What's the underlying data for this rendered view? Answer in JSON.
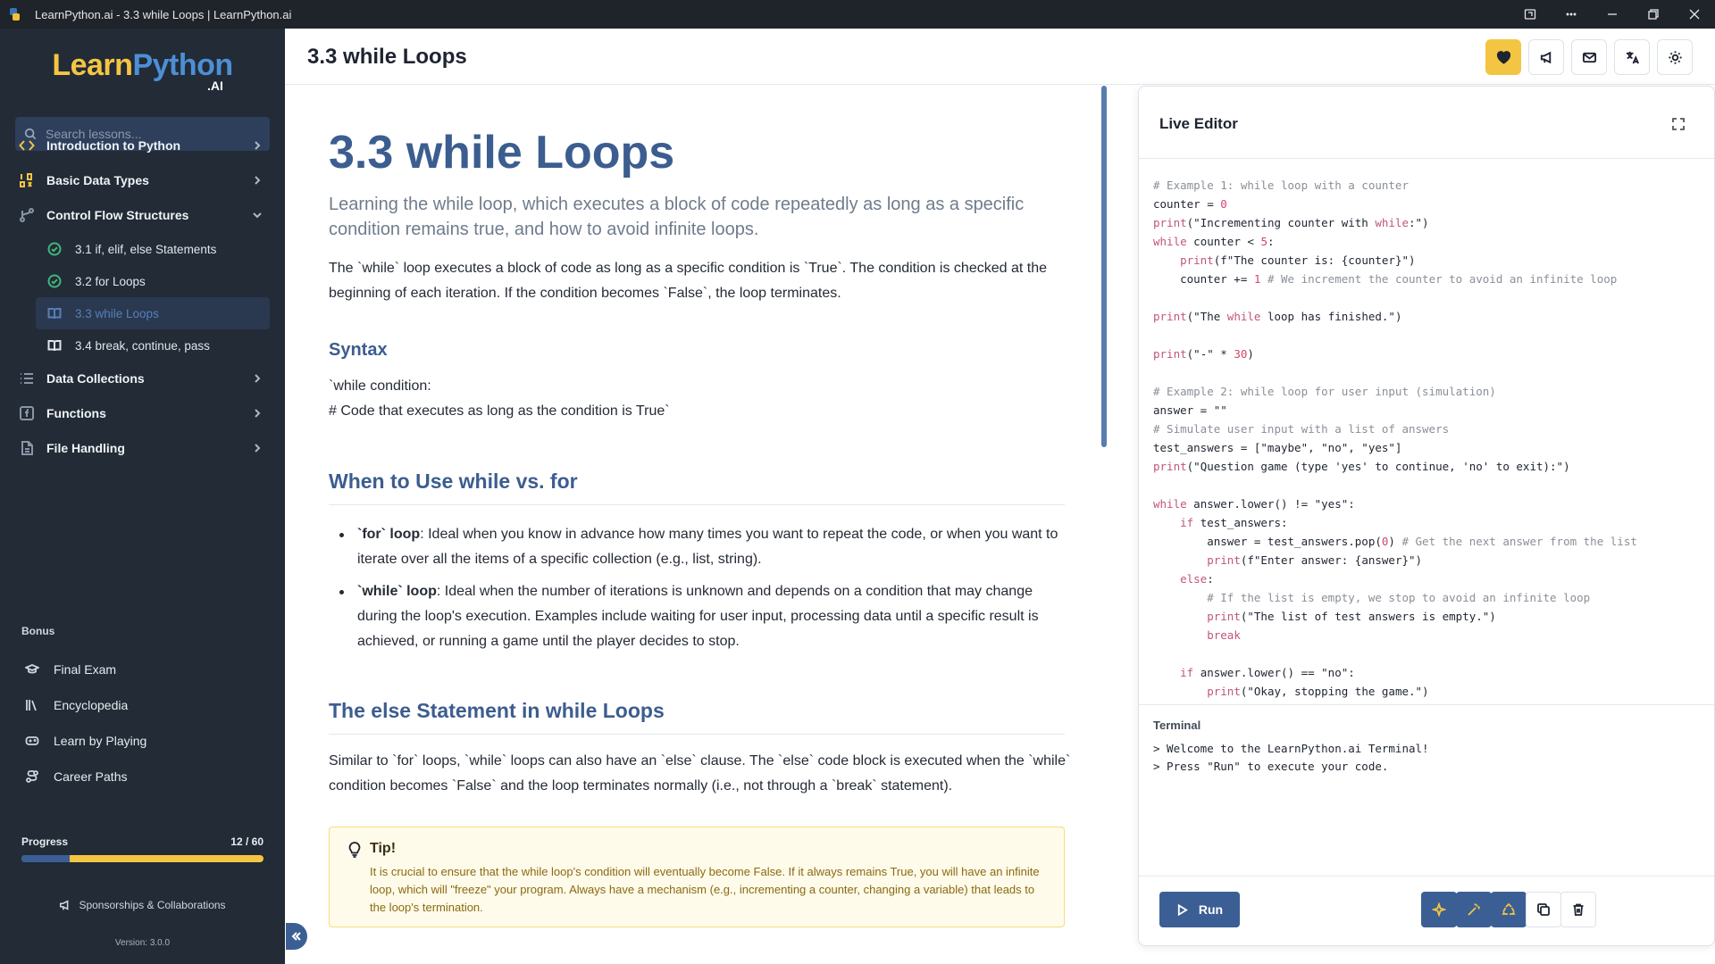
{
  "window": {
    "title": "LearnPython.ai - 3.3 while Loops | LearnPython.ai",
    "controls": [
      "app-view-icon",
      "more-icon",
      "minimize-icon",
      "restore-icon",
      "close-icon"
    ]
  },
  "sidebar": {
    "logo": {
      "learn": "Learn",
      "python": "Python",
      "ai": ".AI"
    },
    "search_placeholder": "Search lessons...",
    "sections": [
      {
        "label": "Introduction to Python",
        "icon": "code-icon",
        "expanded": false
      },
      {
        "label": "Basic Data Types",
        "icon": "data-types-icon",
        "expanded": false
      },
      {
        "label": "Control Flow Structures",
        "icon": "branch-icon",
        "expanded": true
      },
      {
        "label": "Data Collections",
        "icon": "list-icon",
        "expanded": false
      },
      {
        "label": "Functions",
        "icon": "function-icon",
        "expanded": false
      },
      {
        "label": "File Handling",
        "icon": "file-icon",
        "expanded": false
      }
    ],
    "lessons": [
      {
        "label": "3.1 if, elif, else Statements",
        "status": "completed",
        "icon": "check-circle-icon"
      },
      {
        "label": "3.2 for Loops",
        "status": "completed",
        "icon": "check-circle-icon"
      },
      {
        "label": "3.3 while Loops",
        "status": "active",
        "icon": "book-open-icon"
      },
      {
        "label": "3.4 break, continue, pass",
        "status": "pending",
        "icon": "book-open-icon"
      }
    ],
    "bonus_heading": "Bonus",
    "bonus": [
      {
        "label": "Final Exam",
        "icon": "graduation-cap-icon"
      },
      {
        "label": "Encyclopedia",
        "icon": "library-icon"
      },
      {
        "label": "Learn by Playing",
        "icon": "gamepad-icon"
      },
      {
        "label": "Career Paths",
        "icon": "route-icon"
      }
    ],
    "progress": {
      "label": "Progress",
      "text": "12 / 60",
      "fraction": 0.2
    },
    "sponsor": "Sponsorships & Collaborations",
    "version": "Version: 3.0.0"
  },
  "header": {
    "title": "3.3 while Loops",
    "buttons": [
      "heart-icon",
      "megaphone-icon",
      "mail-icon",
      "translate-icon",
      "sun-icon"
    ]
  },
  "article": {
    "h1": "3.3 while Loops",
    "lead": "Learning the while loop, which executes a block of code repeatedly as long as a specific condition remains true, and how to avoid infinite loops.",
    "intro": "The `while` loop executes a block of code as long as a specific condition is `True`. The condition is checked at the beginning of each iteration. If the condition becomes `False`, the loop terminates.",
    "syntax_heading": "Syntax",
    "syntax_line1": "`while condition:",
    "syntax_line2": "# Code that executes as long as the condition is True`",
    "when_heading": "When to Use while vs. for",
    "bullets": [
      {
        "term": "`for` loop",
        "text": ": Ideal when you know in advance how many times you want to repeat the code, or when you want to iterate over all the items of a specific collection (e.g., list, string)."
      },
      {
        "term": "`while` loop",
        "text": ": Ideal when the number of iterations is unknown and depends on a condition that may change during the loop's execution. Examples include waiting for user input, processing data until a specific result is achieved, or running a game until the player decides to stop."
      }
    ],
    "else_heading": "The else Statement in while Loops",
    "else_text": "Similar to `for` loops, `while` loops can also have an `else` clause. The `else` code block is executed when the `while` condition becomes `False` and the loop terminates normally (i.e., not through a `break` statement).",
    "tip_title": "Tip!",
    "tip_text": "It is crucial to ensure that the while loop's condition will eventually become False. If it always remains True, you will have an infinite loop, which will \"freeze\" your program. Always have a mechanism (e.g., incrementing a counter, changing a variable) that leads to the loop's termination."
  },
  "editor": {
    "title": "Live Editor",
    "code": [
      "# Example 1: while loop with a counter",
      "counter = 0",
      "print(\"Incrementing counter with while:\")",
      "while counter < 5:",
      "    print(f\"The counter is: {counter}\")",
      "    counter += 1 # We increment the counter to avoid an infinite loop",
      "",
      "print(\"The while loop has finished.\")",
      "",
      "print(\"-\" * 30)",
      "",
      "# Example 2: while loop for user input (simulation)",
      "answer = \"\"",
      "# Simulate user input with a list of answers",
      "test_answers = [\"maybe\", \"no\", \"yes\"]",
      "print(\"Question game (type 'yes' to continue, 'no' to exit):\")",
      "",
      "while answer.lower() != \"yes\":",
      "    if test_answers:",
      "        answer = test_answers.pop(0) # Get the next answer from the list",
      "        print(f\"Enter answer: {answer}\")",
      "    else:",
      "        # If the list is empty, we stop to avoid an infinite loop",
      "        print(\"The list of test answers is empty.\")",
      "        break",
      "",
      "    if answer.lower() == \"no\":",
      "        print(\"Okay, stopping the game.\")"
    ],
    "terminal_label": "Terminal",
    "terminal_lines": [
      "> Welcome to the LearnPython.ai Terminal!",
      "> Press \"Run\" to execute your code."
    ],
    "run_label": "Run",
    "tools": [
      "sparkles-icon",
      "magic-wand-icon",
      "recycle-icon",
      "copy-icon",
      "trash-icon"
    ]
  },
  "colors": {
    "sidebar_bg": "#222b36",
    "accent_blue": "#3b5f94",
    "accent_yellow": "#f4c542",
    "heading_blue": "#3c5d8f"
  }
}
